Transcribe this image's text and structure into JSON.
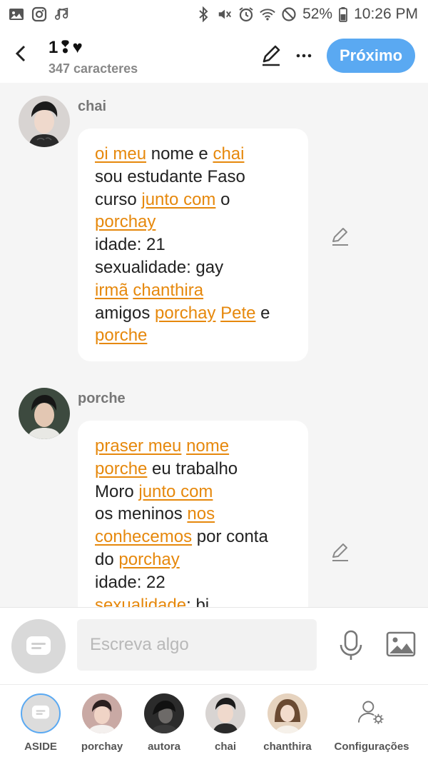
{
  "status_bar": {
    "battery": "52%",
    "time": "10:26 PM"
  },
  "header": {
    "title": "1❢♥",
    "char_count": "347 caracteres",
    "next_label": "Próximo"
  },
  "messages": [
    {
      "author": "chai",
      "lines": [
        [
          {
            "t": "oi meu",
            "link": true
          },
          {
            "t": " nome e ",
            "link": false
          },
          {
            "t": "chai",
            "link": true
          }
        ],
        [
          {
            "t": "sou estudante Faso",
            "link": false
          }
        ],
        [
          {
            "t": "curso ",
            "link": false
          },
          {
            "t": "junto com",
            "link": true
          },
          {
            "t": " o",
            "link": false
          }
        ],
        [
          {
            "t": "porchay",
            "link": true
          }
        ],
        [
          {
            "t": "idade: 21",
            "link": false
          }
        ],
        [
          {
            "t": "sexualidade: gay",
            "link": false
          }
        ],
        [
          {
            "t": "irmã",
            "link": true
          },
          {
            "t": " ",
            "link": false
          },
          {
            "t": "chanthira",
            "link": true
          }
        ],
        [
          {
            "t": "amigos ",
            "link": false
          },
          {
            "t": "porchay",
            "link": true
          },
          {
            "t": " ",
            "link": false
          },
          {
            "t": "Pete",
            "link": true
          },
          {
            "t": " e",
            "link": false
          }
        ],
        [
          {
            "t": "porche",
            "link": true
          }
        ]
      ]
    },
    {
      "author": "porche",
      "lines": [
        [
          {
            "t": "praser meu",
            "link": true
          },
          {
            "t": " ",
            "link": false
          },
          {
            "t": "nome",
            "link": true
          }
        ],
        [
          {
            "t": "porche",
            "link": true
          },
          {
            "t": " eu trabalho",
            "link": false
          }
        ],
        [
          {
            "t": "Moro ",
            "link": false
          },
          {
            "t": "junto com",
            "link": true
          }
        ],
        [
          {
            "t": "os meninos ",
            "link": false
          },
          {
            "t": "nos",
            "link": true
          }
        ],
        [
          {
            "t": "conhecemos",
            "link": true
          },
          {
            "t": " por conta",
            "link": false
          }
        ],
        [
          {
            "t": "do ",
            "link": false
          },
          {
            "t": "porchay",
            "link": true
          }
        ],
        [
          {
            "t": "idade: 22",
            "link": false
          }
        ],
        [
          {
            "t": "sexualidade",
            "link": true
          },
          {
            "t": ": bi",
            "link": false
          }
        ]
      ]
    }
  ],
  "composer": {
    "placeholder": "Escreva algo"
  },
  "tabs": [
    {
      "label": "ASIDE"
    },
    {
      "label": "porchay"
    },
    {
      "label": "autora"
    },
    {
      "label": "chai"
    },
    {
      "label": "chanthira"
    },
    {
      "label": "Configurações"
    }
  ],
  "colors": {
    "link": "#e6880c",
    "accent": "#5aa9f2"
  }
}
